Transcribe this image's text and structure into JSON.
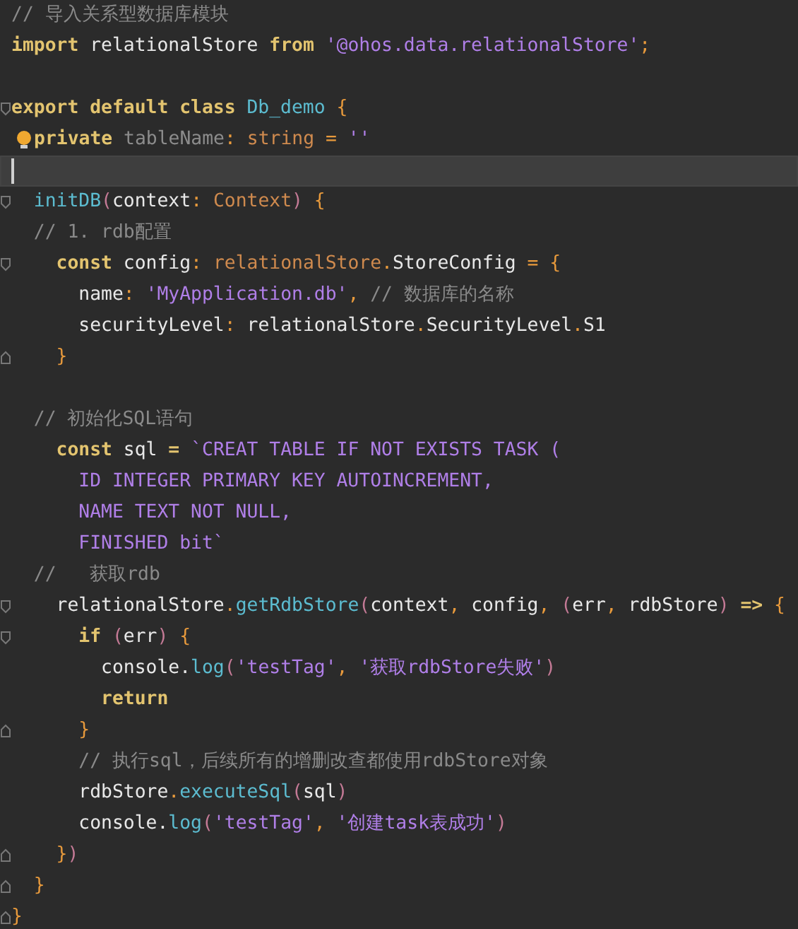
{
  "editor": {
    "lines": [
      {
        "current": false,
        "tokens": [
          {
            "kind": "comment",
            "text": "// 导入关系型数据库模块"
          }
        ]
      },
      {
        "current": false,
        "tokens": [
          {
            "kind": "keyword",
            "text": "import"
          },
          {
            "kind": "plain",
            "text": " relationalStore "
          },
          {
            "kind": "keyword",
            "text": "from "
          },
          {
            "kind": "string",
            "text": "'@ohos.data.relationalStore'"
          },
          {
            "kind": "punct",
            "text": ";"
          }
        ]
      },
      {
        "current": false
      },
      {
        "current": false,
        "fold_start": true,
        "tokens": [
          {
            "kind": "keyword",
            "text": "export default class "
          },
          {
            "kind": "function",
            "text": "Db_demo "
          },
          {
            "kind": "punct",
            "text": "{"
          }
        ]
      },
      {
        "current": false,
        "bulb": true,
        "tokens": [
          {
            "kind": "keyword",
            "text": "private "
          },
          {
            "kind": "field",
            "text": "tableName"
          },
          {
            "kind": "punct",
            "text": ": "
          },
          {
            "kind": "type",
            "text": "string "
          },
          {
            "kind": "punct",
            "text": "= "
          },
          {
            "kind": "string",
            "text": "''"
          }
        ]
      },
      {
        "current": true
      },
      {
        "current": false,
        "fold_start": true,
        "tokens": [
          {
            "kind": "function",
            "text": "  initDB"
          },
          {
            "kind": "paren",
            "text": "("
          },
          {
            "kind": "plain",
            "text": "context"
          },
          {
            "kind": "punct",
            "text": ": "
          },
          {
            "kind": "type",
            "text": "Context"
          },
          {
            "kind": "paren",
            "text": ") "
          },
          {
            "kind": "punct",
            "text": "{"
          }
        ]
      },
      {
        "current": false,
        "tokens": [
          {
            "kind": "comment",
            "text": "  // 1. rdb配置"
          }
        ]
      },
      {
        "current": false,
        "fold_start": true,
        "tokens": [
          {
            "kind": "keyword",
            "text": "    const"
          },
          {
            "kind": "plain",
            "text": " config"
          },
          {
            "kind": "punct",
            "text": ": "
          },
          {
            "kind": "type",
            "text": "relationalStore"
          },
          {
            "kind": "punct",
            "text": "."
          },
          {
            "kind": "plain",
            "text": "StoreConfig "
          },
          {
            "kind": "punct",
            "text": "= {"
          }
        ]
      },
      {
        "current": false,
        "tokens": [
          {
            "kind": "plain",
            "text": "      name"
          },
          {
            "kind": "punct",
            "text": ": "
          },
          {
            "kind": "string",
            "text": "'MyApplication.db'"
          },
          {
            "kind": "punct",
            "text": ", "
          },
          {
            "kind": "comment",
            "text": "// 数据库的名称"
          }
        ]
      },
      {
        "current": false,
        "tokens": [
          {
            "kind": "plain",
            "text": "      securityLevel"
          },
          {
            "kind": "punct",
            "text": ":"
          },
          {
            "kind": "plain",
            "text": " relationalStore"
          },
          {
            "kind": "punct",
            "text": "."
          },
          {
            "kind": "plain",
            "text": "SecurityLevel"
          },
          {
            "kind": "punct",
            "text": "."
          },
          {
            "kind": "plain",
            "text": "S1"
          }
        ]
      },
      {
        "current": false,
        "fold_end": true,
        "tokens": [
          {
            "kind": "punct",
            "text": "    }"
          }
        ]
      },
      {
        "current": false
      },
      {
        "current": false,
        "tokens": [
          {
            "kind": "comment",
            "text": "  // 初始化SQL语句"
          }
        ]
      },
      {
        "current": false,
        "tokens": [
          {
            "kind": "keyword",
            "text": "    const"
          },
          {
            "kind": "plain",
            "text": " sql "
          },
          {
            "kind": "keyword",
            "text": "= "
          },
          {
            "kind": "string",
            "text": "`CREAT TABLE IF NOT EXISTS TASK ("
          }
        ]
      },
      {
        "current": false,
        "tokens": [
          {
            "kind": "string",
            "text": "      ID INTEGER PRIMARY KEY AUTOINCREMENT,"
          }
        ]
      },
      {
        "current": false,
        "tokens": [
          {
            "kind": "string",
            "text": "      NAME TEXT NOT NULL,"
          }
        ]
      },
      {
        "current": false,
        "tokens": [
          {
            "kind": "string",
            "text": "      FINISHED bit`"
          }
        ]
      },
      {
        "current": false,
        "tokens": [
          {
            "kind": "comment",
            "text": "  //   获取rdb"
          }
        ]
      },
      {
        "current": false,
        "fold_start": true,
        "tokens": [
          {
            "kind": "plain",
            "text": "    relationalStore"
          },
          {
            "kind": "punct",
            "text": "."
          },
          {
            "kind": "function",
            "text": "getRdbStore"
          },
          {
            "kind": "paren",
            "text": "("
          },
          {
            "kind": "plain",
            "text": "context"
          },
          {
            "kind": "punct",
            "text": ", "
          },
          {
            "kind": "plain",
            "text": "config"
          },
          {
            "kind": "punct",
            "text": ", "
          },
          {
            "kind": "paren",
            "text": "("
          },
          {
            "kind": "plain",
            "text": "err"
          },
          {
            "kind": "punct",
            "text": ", "
          },
          {
            "kind": "plain",
            "text": "rdbStore"
          },
          {
            "kind": "paren",
            "text": ") "
          },
          {
            "kind": "keyword",
            "text": "=> "
          },
          {
            "kind": "punct",
            "text": "{"
          }
        ]
      },
      {
        "current": false,
        "fold_start": true,
        "tokens": [
          {
            "kind": "keyword",
            "text": "      if "
          },
          {
            "kind": "paren",
            "text": "("
          },
          {
            "kind": "plain",
            "text": "err"
          },
          {
            "kind": "paren",
            "text": ") "
          },
          {
            "kind": "punct",
            "text": "{"
          }
        ]
      },
      {
        "current": false,
        "tokens": [
          {
            "kind": "plain",
            "text": "        console."
          },
          {
            "kind": "function",
            "text": "log"
          },
          {
            "kind": "paren",
            "text": "("
          },
          {
            "kind": "string",
            "text": "'testTag'"
          },
          {
            "kind": "punct",
            "text": ", "
          },
          {
            "kind": "string",
            "text": "'获取rdbStore失败'"
          },
          {
            "kind": "paren",
            "text": ")"
          }
        ]
      },
      {
        "current": false,
        "tokens": [
          {
            "kind": "keyword",
            "text": "        return"
          }
        ]
      },
      {
        "current": false,
        "fold_end": true,
        "tokens": [
          {
            "kind": "punct",
            "text": "      }"
          }
        ]
      },
      {
        "current": false,
        "tokens": [
          {
            "kind": "comment",
            "text": "      // 执行sql，后续所有的增删改查都使用rdbStore对象"
          }
        ]
      },
      {
        "current": false,
        "tokens": [
          {
            "kind": "plain",
            "text": "      rdbStore"
          },
          {
            "kind": "punct",
            "text": "."
          },
          {
            "kind": "function",
            "text": "executeSql"
          },
          {
            "kind": "paren",
            "text": "("
          },
          {
            "kind": "plain",
            "text": "sql"
          },
          {
            "kind": "paren",
            "text": ")"
          }
        ]
      },
      {
        "current": false,
        "tokens": [
          {
            "kind": "plain",
            "text": "      console."
          },
          {
            "kind": "function",
            "text": "log"
          },
          {
            "kind": "paren",
            "text": "("
          },
          {
            "kind": "string",
            "text": "'testTag'"
          },
          {
            "kind": "punct",
            "text": ", "
          },
          {
            "kind": "string",
            "text": "'创建task表成功'"
          },
          {
            "kind": "paren",
            "text": ")"
          }
        ]
      },
      {
        "current": false,
        "fold_end": true,
        "tokens": [
          {
            "kind": "punct",
            "text": "    }"
          },
          {
            "kind": "paren",
            "text": ")"
          }
        ]
      },
      {
        "current": false,
        "fold_end": true,
        "tokens": [
          {
            "kind": "punct",
            "text": "  }"
          }
        ]
      },
      {
        "current": false,
        "fold_end": true,
        "tokens": [
          {
            "kind": "punct",
            "text": "}"
          }
        ]
      }
    ]
  }
}
